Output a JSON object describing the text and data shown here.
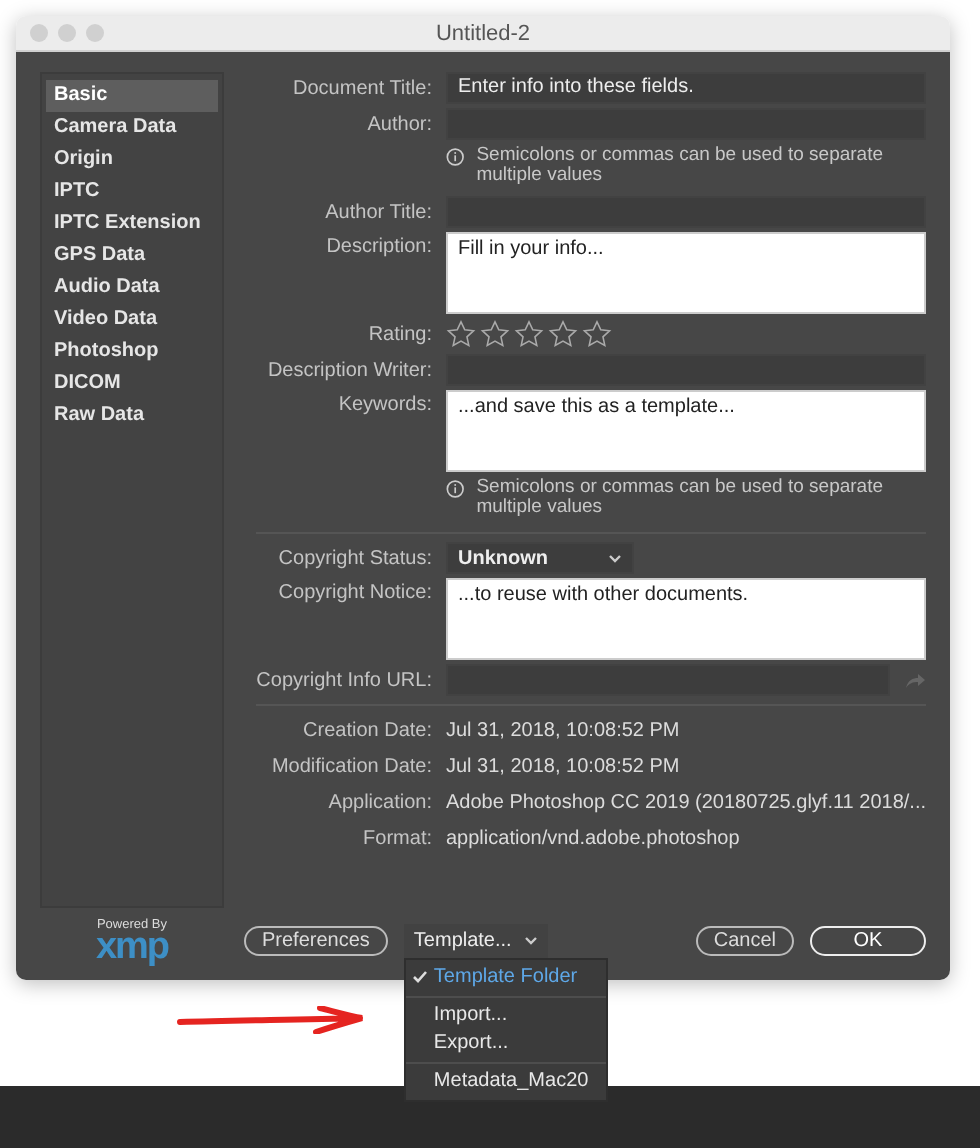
{
  "window": {
    "title": "Untitled-2"
  },
  "sidebar": {
    "items": [
      {
        "label": "Basic",
        "selected": true
      },
      {
        "label": "Camera Data",
        "selected": false
      },
      {
        "label": "Origin",
        "selected": false
      },
      {
        "label": "IPTC",
        "selected": false
      },
      {
        "label": "IPTC Extension",
        "selected": false
      },
      {
        "label": "GPS Data",
        "selected": false
      },
      {
        "label": "Audio Data",
        "selected": false
      },
      {
        "label": "Video Data",
        "selected": false
      },
      {
        "label": "Photoshop",
        "selected": false
      },
      {
        "label": "DICOM",
        "selected": false
      },
      {
        "label": "Raw Data",
        "selected": false
      }
    ]
  },
  "form": [
    {
      "kind": "text",
      "label": "Document Title:",
      "value": "Enter info into these fields."
    },
    {
      "kind": "text",
      "label": "Author:"
    },
    {
      "kind": "hint",
      "text": "Semicolons or commas can be used to separate multiple values"
    },
    {
      "kind": "text",
      "label": "Author Title:"
    },
    {
      "kind": "textarea",
      "label": "Description:",
      "value": "Fill in your info..."
    },
    {
      "kind": "rating",
      "label": "Rating:",
      "stars": 0
    },
    {
      "kind": "text",
      "label": "Description Writer:"
    },
    {
      "kind": "textarea",
      "label": "Keywords:",
      "value": "...and save this as a template..."
    },
    {
      "kind": "hint",
      "text": "Semicolons or commas can be used to separate multiple values"
    },
    {
      "kind": "divider"
    },
    {
      "kind": "select",
      "label": "Copyright Status:",
      "value": "Unknown"
    },
    {
      "kind": "textarea",
      "label": "Copyright Notice:",
      "value": "...to reuse with other documents."
    },
    {
      "kind": "url",
      "label": "Copyright Info URL:"
    },
    {
      "kind": "divider"
    },
    {
      "kind": "info",
      "label": "Creation Date:",
      "value": "Jul 31, 2018, 10:08:52 PM"
    },
    {
      "kind": "info",
      "label": "Modification Date:",
      "value": "Jul 31, 2018, 10:08:52 PM"
    },
    {
      "kind": "info",
      "label": "Application:",
      "value": "Adobe Photoshop CC 2019 (20180725.glyf.11 2018/..."
    },
    {
      "kind": "info",
      "label": "Format:",
      "value": "application/vnd.adobe.photoshop"
    }
  ],
  "footer": {
    "powered_by": "Powered By",
    "logo": "xmp",
    "buttons": [
      {
        "label": "Preferences",
        "kind": "pill"
      },
      {
        "label": "Template...",
        "kind": "menu"
      },
      {
        "label": "Cancel",
        "kind": "pill"
      },
      {
        "label": "OK",
        "kind": "default"
      }
    ]
  },
  "template_menu": {
    "groups": [
      [
        {
          "label": "Template Folder",
          "checked": true
        }
      ],
      [
        {
          "label": "Import...",
          "checked": false
        },
        {
          "label": "Export...",
          "checked": false
        }
      ],
      [
        {
          "label": "Metadata_Mac20",
          "checked": false
        }
      ]
    ]
  }
}
